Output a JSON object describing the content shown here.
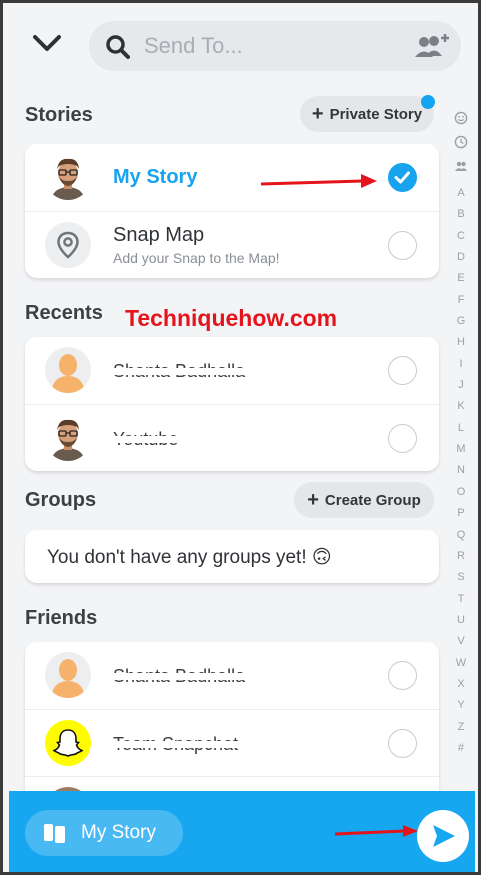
{
  "search": {
    "placeholder": "Send To..."
  },
  "stories": {
    "title": "Stories",
    "private_story_label": "Private Story",
    "items": [
      {
        "name": "My Story",
        "subtitle": "",
        "selected": true
      },
      {
        "name": "Snap Map",
        "subtitle": "Add your Snap to the Map!",
        "selected": false
      }
    ]
  },
  "watermark": "Techniquehow.com",
  "recents": {
    "title": "Recents",
    "items": [
      {
        "name": "Shanta Badhalla",
        "selected": false
      },
      {
        "name": "Youtube",
        "selected": false
      }
    ]
  },
  "groups": {
    "title": "Groups",
    "create_label": "Create Group",
    "empty_text": "You don't have any groups yet! 🙃"
  },
  "friends": {
    "title": "Friends",
    "items": [
      {
        "name": "Shanta Badhalla",
        "selected": false
      },
      {
        "name": "Team Snapchat",
        "selected": false
      }
    ]
  },
  "index_letters": [
    "A",
    "B",
    "C",
    "D",
    "E",
    "F",
    "G",
    "H",
    "I",
    "J",
    "K",
    "L",
    "M",
    "N",
    "O",
    "P",
    "Q",
    "R",
    "S",
    "T",
    "U",
    "V",
    "W",
    "X",
    "Y",
    "Z",
    "#"
  ],
  "bottom_bar": {
    "story_label": "My Story"
  },
  "colors": {
    "accent": "#18a3ef",
    "bar": "#17a6f0",
    "annotation": "#e4141c"
  }
}
